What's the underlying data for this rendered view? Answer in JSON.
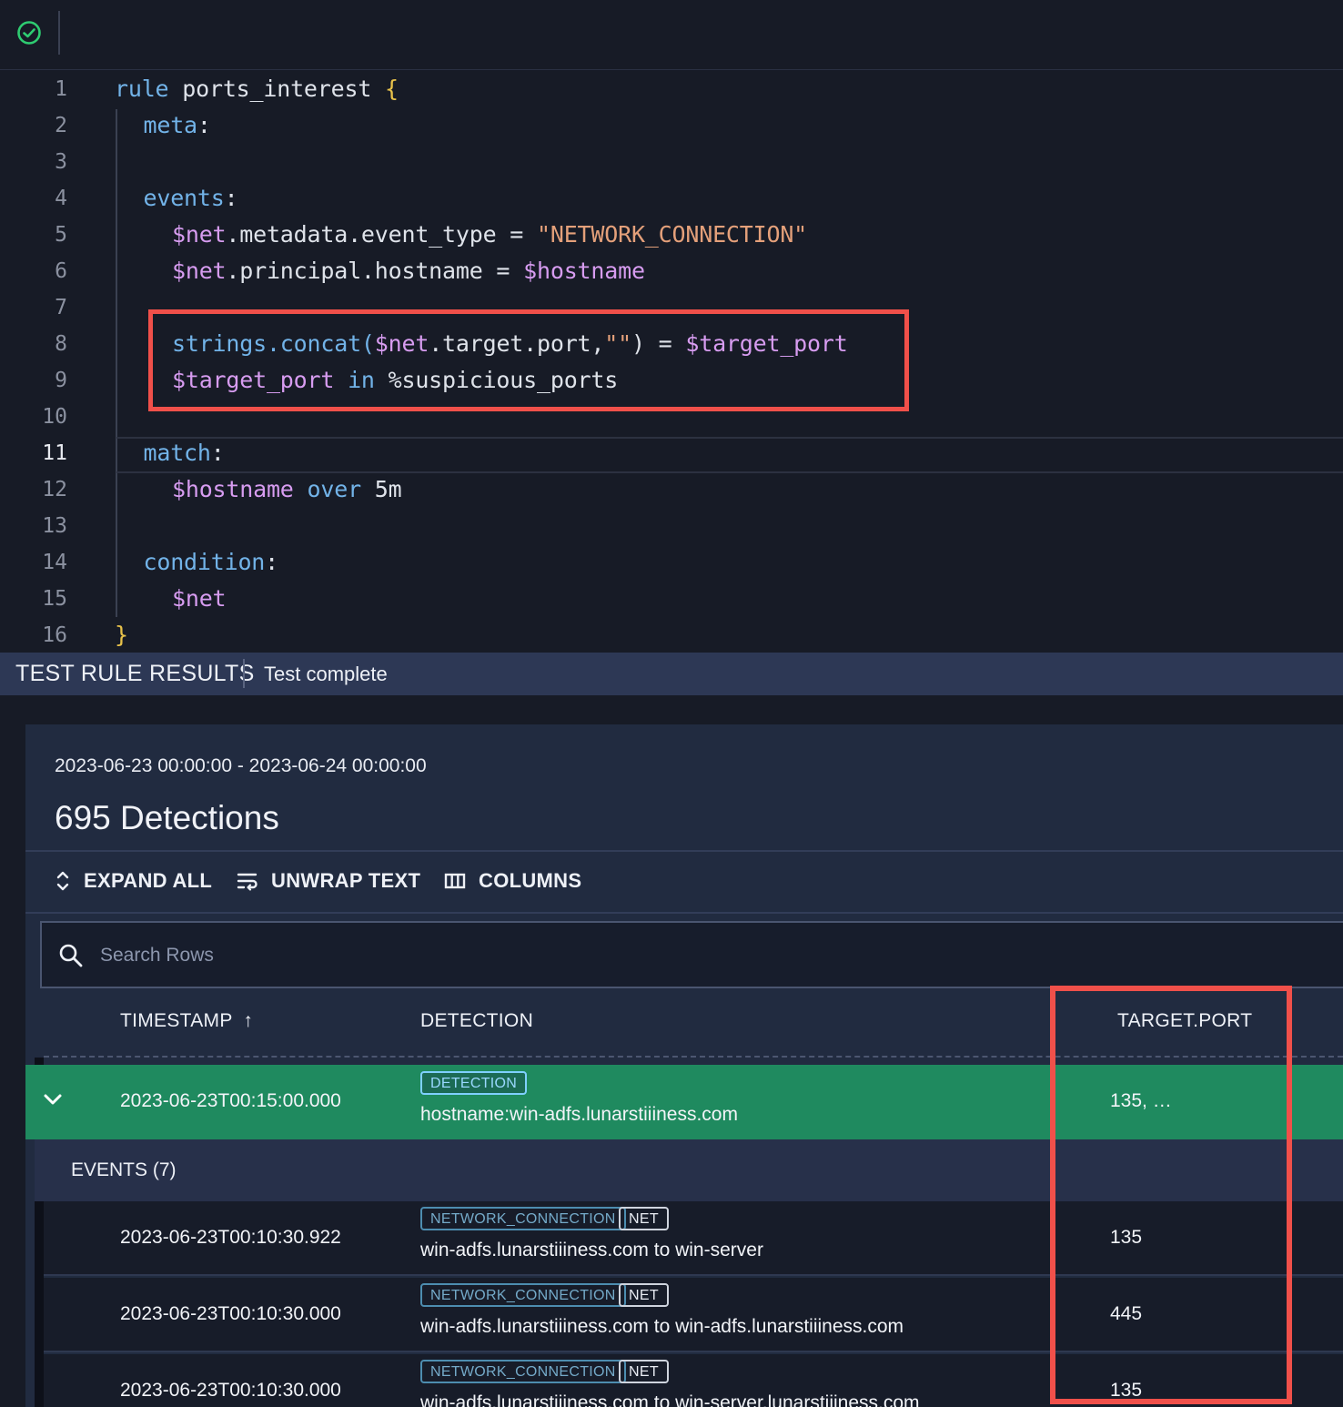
{
  "editor": {
    "lines": [
      {
        "n": "1",
        "tokens": [
          {
            "t": "rule ",
            "c": "kw"
          },
          {
            "t": "ports_interest ",
            "c": "plain"
          },
          {
            "t": "{",
            "c": "brace"
          }
        ],
        "indent": 0
      },
      {
        "n": "2",
        "tokens": [
          {
            "t": "meta",
            "c": "kw"
          },
          {
            "t": ":",
            "c": "plain"
          }
        ],
        "indent": 1
      },
      {
        "n": "3",
        "tokens": [],
        "indent": 0
      },
      {
        "n": "4",
        "tokens": [
          {
            "t": "events",
            "c": "kw"
          },
          {
            "t": ":",
            "c": "plain"
          }
        ],
        "indent": 1
      },
      {
        "n": "5",
        "tokens": [
          {
            "t": "$net",
            "c": "var"
          },
          {
            "t": ".metadata.event_type = ",
            "c": "plain"
          },
          {
            "t": "\"NETWORK_CONNECTION\"",
            "c": "str"
          }
        ],
        "indent": 2
      },
      {
        "n": "6",
        "tokens": [
          {
            "t": "$net",
            "c": "var"
          },
          {
            "t": ".principal.hostname = ",
            "c": "plain"
          },
          {
            "t": "$hostname",
            "c": "var"
          }
        ],
        "indent": 2
      },
      {
        "n": "7",
        "tokens": [],
        "indent": 0
      },
      {
        "n": "8",
        "tokens": [
          {
            "t": "strings.concat(",
            "c": "kw"
          },
          {
            "t": "$net",
            "c": "var"
          },
          {
            "t": ".target.port,",
            "c": "plain"
          },
          {
            "t": "\"\"",
            "c": "str"
          },
          {
            "t": ") = ",
            "c": "plain"
          },
          {
            "t": "$target_port",
            "c": "var"
          }
        ],
        "indent": 2
      },
      {
        "n": "9",
        "tokens": [
          {
            "t": "$target_port",
            "c": "var"
          },
          {
            "t": " in ",
            "c": "kw"
          },
          {
            "t": "%suspicious_ports",
            "c": "plain"
          }
        ],
        "indent": 2
      },
      {
        "n": "10",
        "tokens": [],
        "indent": 0
      },
      {
        "n": "11",
        "tokens": [
          {
            "t": "match",
            "c": "kw"
          },
          {
            "t": ":",
            "c": "plain"
          }
        ],
        "indent": 1,
        "active": true
      },
      {
        "n": "12",
        "tokens": [
          {
            "t": "$hostname",
            "c": "var"
          },
          {
            "t": " over ",
            "c": "kw"
          },
          {
            "t": "5m",
            "c": "plain"
          }
        ],
        "indent": 2
      },
      {
        "n": "13",
        "tokens": [],
        "indent": 0
      },
      {
        "n": "14",
        "tokens": [
          {
            "t": "condition",
            "c": "kw"
          },
          {
            "t": ":",
            "c": "plain"
          }
        ],
        "indent": 1
      },
      {
        "n": "15",
        "tokens": [
          {
            "t": "$net",
            "c": "var"
          }
        ],
        "indent": 2
      },
      {
        "n": "16",
        "tokens": [
          {
            "t": "}",
            "c": "brace"
          }
        ],
        "indent": 0
      }
    ]
  },
  "results_bar": {
    "title": "TEST RULE RESULTS",
    "status": "Test complete"
  },
  "panel": {
    "date_range": "2023-06-23 00:00:00 - 2023-06-24 00:00:00",
    "detections_count": "695 Detections",
    "toolbar": {
      "expand_all": "EXPAND ALL",
      "unwrap_text": "UNWRAP TEXT",
      "columns": "COLUMNS"
    },
    "search": {
      "placeholder": "Search Rows",
      "value": ""
    },
    "table": {
      "headers": {
        "timestamp": "TIMESTAMP",
        "sort_arrow": "↑",
        "detection": "DETECTION",
        "target_port": "TARGET.PORT"
      },
      "detection_row": {
        "timestamp": "2023-06-23T00:15:00.000",
        "tag": "DETECTION",
        "text": "hostname:win-adfs.lunarstiiiness.com",
        "target_port": "135, …"
      },
      "events_label": "EVENTS (7)",
      "events": [
        {
          "timestamp": "2023-06-23T00:10:30.922",
          "tag1": "NETWORK_CONNECTION",
          "tag2": "NET",
          "text": "win-adfs.lunarstiiiness.com to win-server",
          "port": "135"
        },
        {
          "timestamp": "2023-06-23T00:10:30.000",
          "tag1": "NETWORK_CONNECTION",
          "tag2": "NET",
          "text": "win-adfs.lunarstiiiness.com to win-adfs.lunarstiiiness.com",
          "port": "445"
        },
        {
          "timestamp": "2023-06-23T00:10:30.000",
          "tag1": "NETWORK_CONNECTION",
          "tag2": "NET",
          "text": "win-adfs.lunarstiiiness.com to win-server.lunarstiiiness.com",
          "port": "135"
        }
      ]
    }
  },
  "colors": {
    "accent_green": "#1f8a5f",
    "highlight_red": "#f0504a",
    "keyword_blue": "#72b3e8",
    "variable_purple": "#d79cf0",
    "string_orange": "#e4a07a",
    "brace_yellow": "#e8c24a",
    "status_ok_green": "#2ecc71"
  },
  "icons": {
    "status": "check-circle-icon",
    "expand_all": "unfold-icon",
    "unwrap_text": "wrap-text-icon",
    "columns": "columns-icon",
    "search": "search-icon",
    "row_toggle": "chevron-down-icon"
  }
}
